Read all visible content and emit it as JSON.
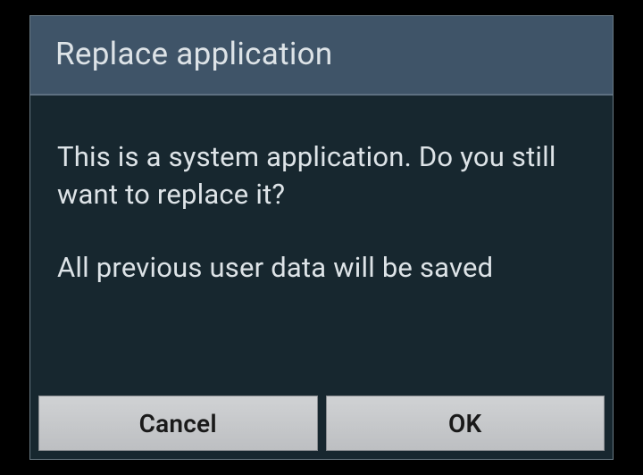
{
  "dialog": {
    "title": "Replace application",
    "body": {
      "line1": "This is a system application. Do you still want to replace it?",
      "line2": "All previous user data will be saved"
    },
    "actions": {
      "cancel": "Cancel",
      "ok": "OK"
    }
  }
}
